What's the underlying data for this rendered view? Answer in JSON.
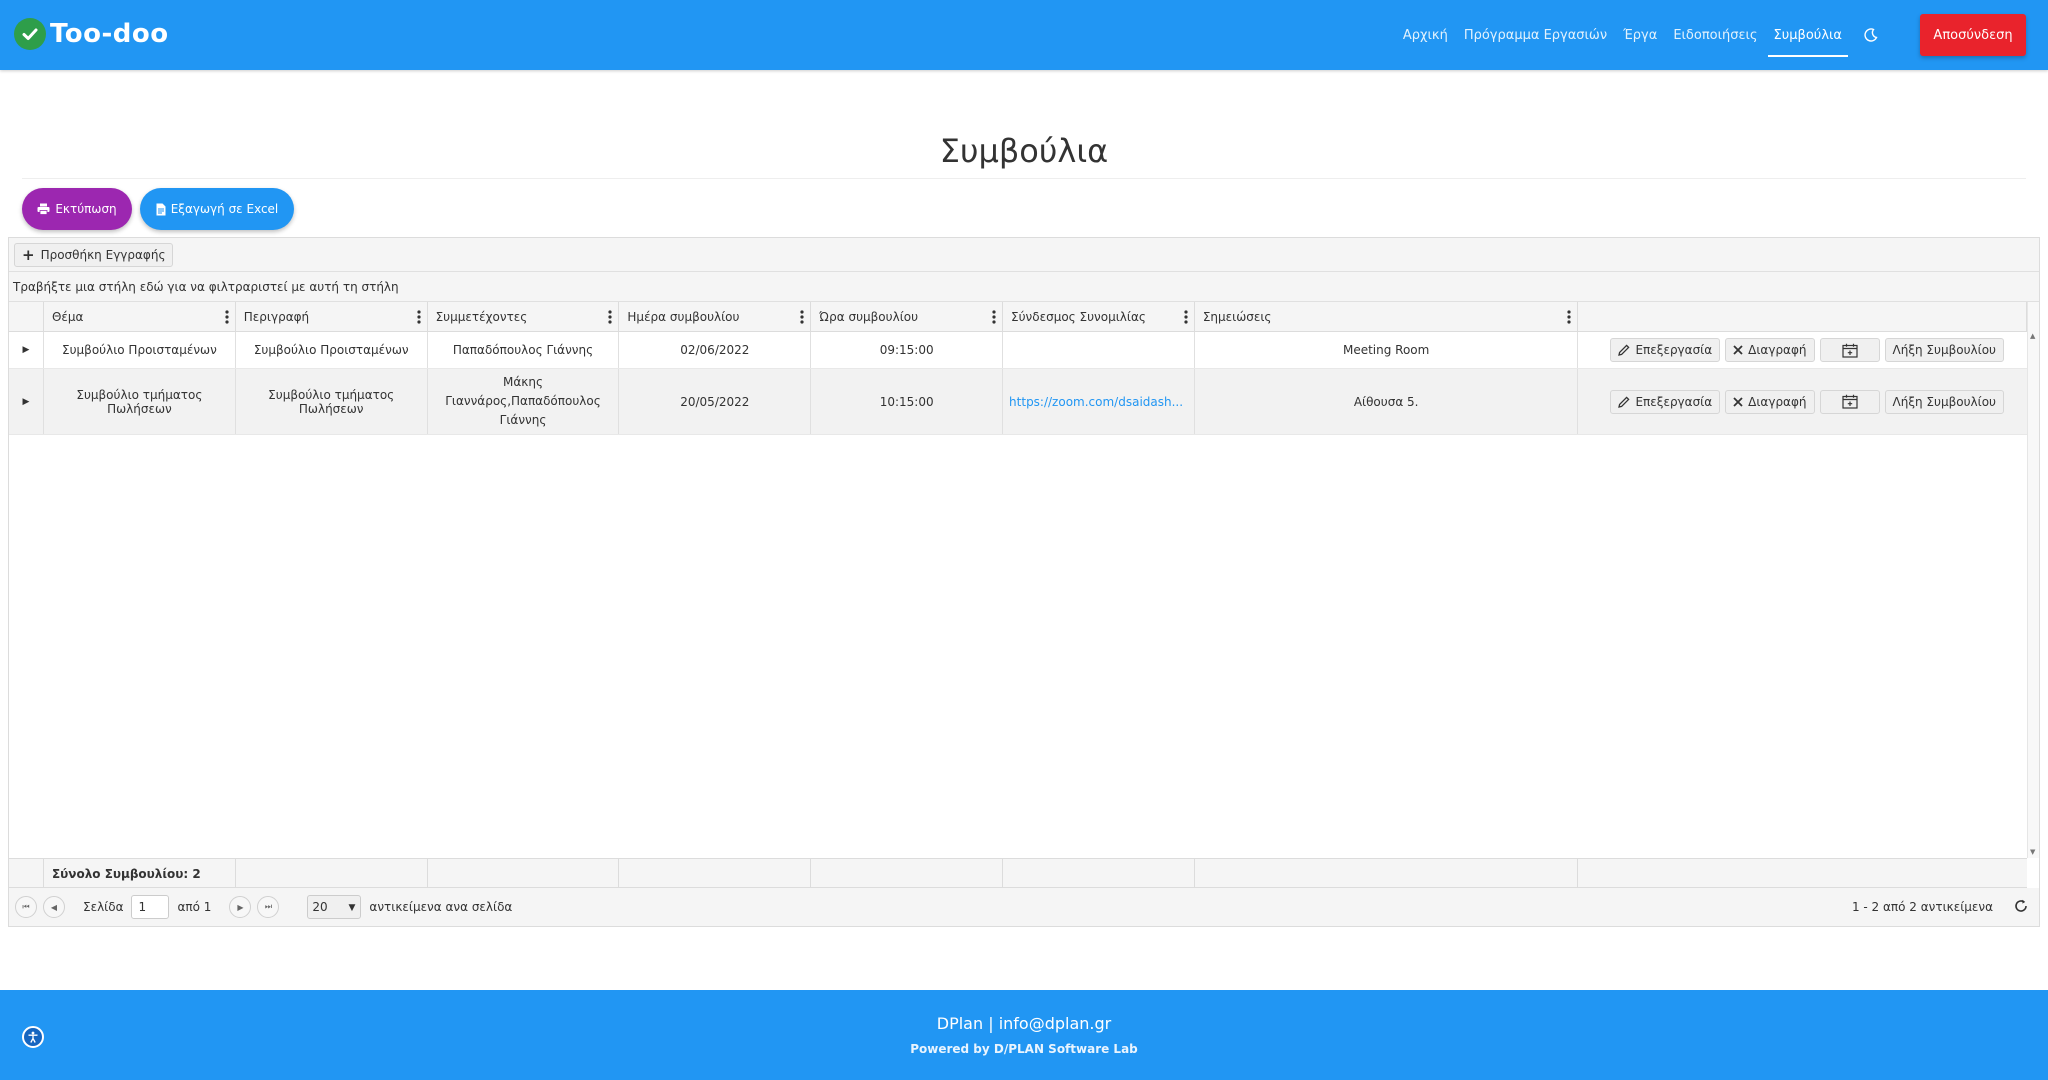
{
  "app": {
    "name": "Too-doo"
  },
  "nav": {
    "items": [
      "Αρχική",
      "Πρόγραμμα Εργασιών",
      "Έργα",
      "Ειδοποιήσεις",
      "Συμβούλια"
    ],
    "active": "Συμβούλια",
    "logout": "Αποσύνδεση"
  },
  "page": {
    "title": "Συμβούλια"
  },
  "actions": {
    "print": "Εκτύπωση",
    "excel": "Εξαγωγή σε Excel"
  },
  "grid": {
    "add_record": "Προσθήκη Εγγραφής",
    "group_hint": "Τραβήξτε μια στήλη εδώ για να φιλτραριστεί με αυτή τη στήλη",
    "columns": [
      "Θέμα",
      "Περιγραφή",
      "Συμμετέχοντες",
      "Ημέρα συμβουλίου",
      "Ώρα συμβουλίου",
      "Σύνδεσμος Συνομιλίας",
      "Σημειώσεις"
    ],
    "rows": [
      {
        "subject": "Συμβούλιο Προισταμένων",
        "description": "Συμβούλιο Προισταμένων",
        "participants": "Παπαδόπουλος Γιάννης",
        "date": "02/06/2022",
        "time": "09:15:00",
        "link": "",
        "notes": "Meeting Room"
      },
      {
        "subject": "Συμβούλιο τμήματος Πωλήσεων",
        "description": "Συμβούλιο τμήματος Πωλήσεων",
        "participants": "Μάκης Γιαννάρος,Παπαδόπουλος Γιάννης",
        "date": "20/05/2022",
        "time": "10:15:00",
        "link": "https://zoom.com/dsaidash...",
        "notes": "Αίθουσα 5."
      }
    ],
    "row_actions": {
      "edit": "Επεξεργασία",
      "delete": "Διαγραφή",
      "end": "Λήξη Συμβουλίου"
    },
    "footer_total": "Σύνολο Συμβουλίου: 2",
    "pager": {
      "page_label": "Σελίδα",
      "page": "1",
      "of": "από 1",
      "page_size": "20",
      "per_page_label": "αντικείμενα ανα σελίδα",
      "info": "1 - 2 από 2 αντικείμενα"
    }
  },
  "footer": {
    "main": "DPlan | info@dplan.gr",
    "sub": "Powered by D/PLAN Software Lab"
  },
  "colors": {
    "primary": "#2196f3",
    "danger": "#e9232c",
    "print": "#9c27b0",
    "brand_check": "#2e9e4a"
  }
}
